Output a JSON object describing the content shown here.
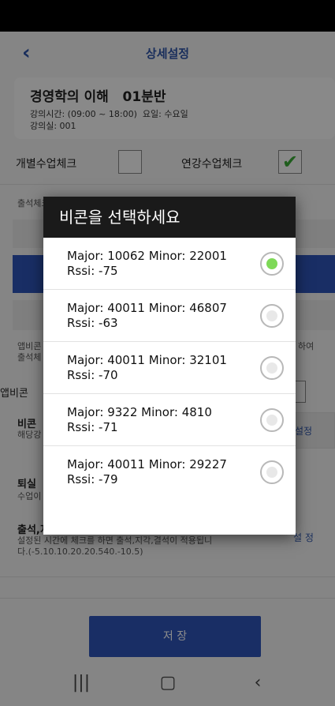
{
  "header": {
    "back_icon": "chevron-left-icon",
    "title": "상세설정"
  },
  "course": {
    "name": "경영학의 이해",
    "section": "01분반",
    "time_label": "강의시간: (09:00 ~ 18:00)",
    "day_label": "요일: 수요일",
    "room": "강의실: 001"
  },
  "checks": {
    "individual_label": "개별수업체크",
    "individual_checked": false,
    "annual_label": "연강수업체크",
    "annual_checked": true
  },
  "background": {
    "attendance_label": "출석체크 방법설정",
    "appbeacon_desc_left": "앱비콘",
    "appbeacon_desc_left2": "출석체",
    "appbeacon_desc_right": "하여",
    "appbeacon_label": "앱비콘",
    "beacon_label": "비콘",
    "beacon_sub": "해당강",
    "beacon_btn": "설정",
    "leave_label": "퇴실",
    "leave_sub": "수업이",
    "time_setting_title": "출석,지각,결석,퇴실 시간설정",
    "time_setting_desc": "설정된 시간에 체크를 하면 출석,지각,결석이 적용됩니다.(-5.10.10.20.20.540.-10.5)",
    "time_setting_btn": "설 정"
  },
  "save_label": "저 장",
  "nav": {
    "recent_icon": "recents-icon",
    "home_icon": "home-icon",
    "back_icon": "back-icon"
  },
  "dialog": {
    "title": "비콘을 선택하세요",
    "beacons": [
      {
        "major": "Major: 10062",
        "minor": "Minor: 22001",
        "rssi": "Rssi: -75",
        "selected": true
      },
      {
        "major": "Major: 40011",
        "minor": "Minor: 46807",
        "rssi": "Rssi: -63",
        "selected": false
      },
      {
        "major": "Major: 40011",
        "minor": "Minor: 32101",
        "rssi": "Rssi: -70",
        "selected": false
      },
      {
        "major": "Major: 9322",
        "minor": "Minor: 4810",
        "rssi": "Rssi: -71",
        "selected": false
      },
      {
        "major": "Major: 40011",
        "minor": "Minor: 29227",
        "rssi": "Rssi: -79",
        "selected": false
      }
    ]
  },
  "colors": {
    "accent": "#2f55a8",
    "check_green": "#3aaa35",
    "radio_selected": "#7ed957",
    "dialog_header": "#1a1a1a"
  }
}
